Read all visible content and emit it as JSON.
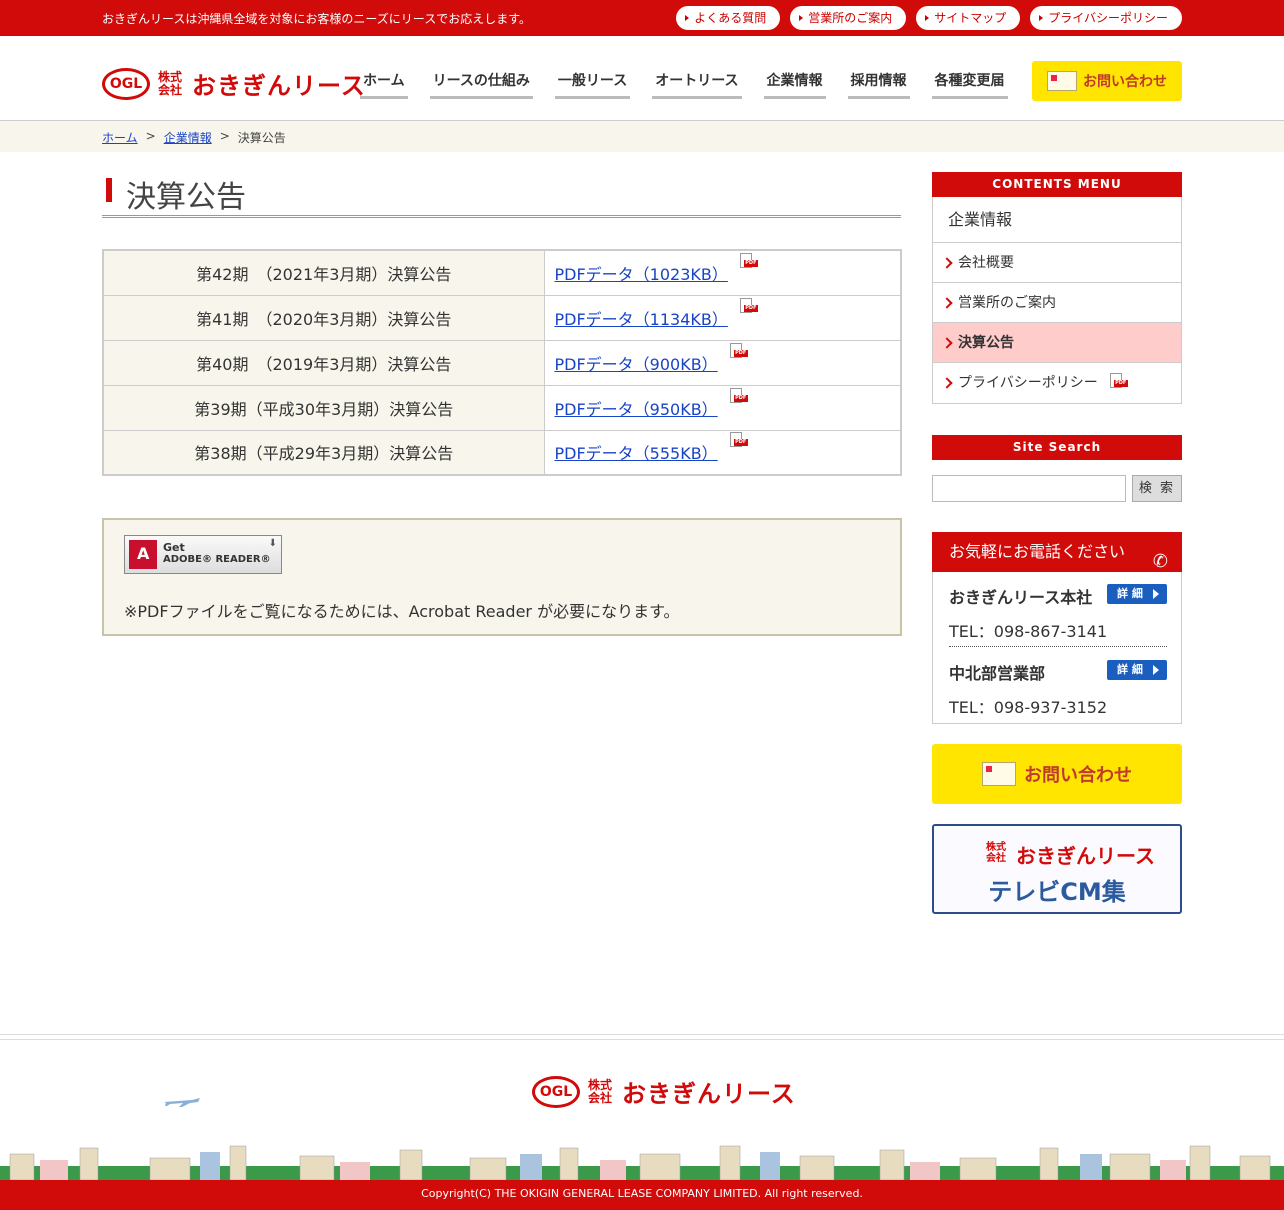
{
  "topbar": {
    "tagline": "おきぎんリースは沖縄県全域を対象にお客様のニーズにリースでお応えします。",
    "links": [
      "よくある質問",
      "営業所のご案内",
      "サイトマップ",
      "プライバシーポリシー"
    ]
  },
  "header": {
    "logo_mark": "OGL",
    "logo_kabushiki": "株式会社",
    "logo_name": "おきぎんリース",
    "nav": [
      "ホーム",
      "リースの仕組み",
      "一般リース",
      "オートリース",
      "企業情報",
      "採用情報",
      "各種変更届"
    ],
    "contact_label": "お問い合わせ"
  },
  "breadcrumb": {
    "home": "ホーム",
    "separator": ">",
    "parent": "企業情報",
    "current": "決算公告"
  },
  "main": {
    "title": "決算公告",
    "reports": [
      {
        "label": "第42期　（2021年3月期）決算公告",
        "link": "PDFデータ（1023KB）"
      },
      {
        "label": "第41期　（2020年3月期）決算公告",
        "link": "PDFデータ（1134KB）"
      },
      {
        "label": "第40期　（2019年3月期）決算公告",
        "link": "PDFデータ（900KB）"
      },
      {
        "label": "第39期（平成30年3月期）決算公告",
        "link": "PDFデータ（950KB）"
      },
      {
        "label": "第38期（平成29年3月期）決算公告",
        "link": "PDFデータ（555KB）"
      }
    ],
    "pdf_tag": "PDF",
    "reader_badge": {
      "get": "Get",
      "product": "ADOBE® READER®"
    },
    "reader_note": "※PDFファイルをご覧になるためには、Acrobat Reader が必要になります。"
  },
  "sidebar": {
    "contents_menu_title": "CONTENTS MENU",
    "category": "企業情報",
    "items": [
      "会社概要",
      "営業所のご案内",
      "決算公告",
      "プライバシーポリシー"
    ],
    "site_search_title": "Site Search",
    "search_button": "検 索",
    "phone_title": "お気軽にお電話ください",
    "offices": [
      {
        "name": "おきぎんリース本社",
        "tel": "TEL：098-867-3141",
        "detail": "詳 細"
      },
      {
        "name": "中北部営業部",
        "tel": "TEL：098-937-3152",
        "detail": "詳 細"
      }
    ],
    "contact_label": "お問い合わせ",
    "cm_banner": {
      "kabushiki": "株式会社",
      "brand": "おきぎんリース",
      "title": "テレビCM集"
    }
  },
  "footer": {
    "copyright": "Copyright(C) THE OKIGIN GENERAL LEASE COMPANY LIMITED. All right reserved."
  },
  "colors": {
    "brand_red": "#d10a0a",
    "link_blue": "#1a44c8",
    "contact_yellow": "#ffe500",
    "active_pink": "#ffcccc"
  }
}
